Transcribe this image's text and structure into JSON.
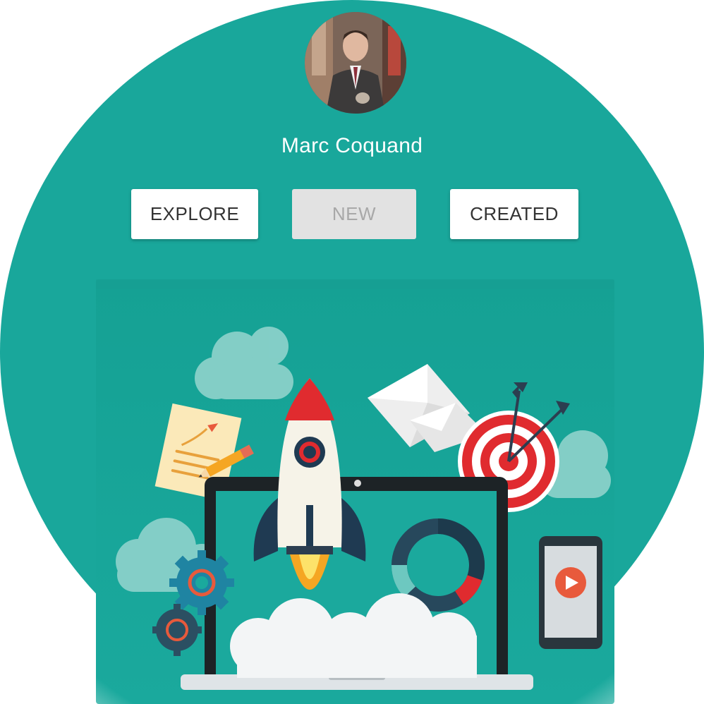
{
  "profile": {
    "name": "Marc Coquand",
    "avatar_icon": "user-photo"
  },
  "tabs": [
    {
      "label": "EXPLORE",
      "active": false
    },
    {
      "label": "NEW",
      "active": true
    },
    {
      "label": "CREATED",
      "active": false
    }
  ],
  "illustration": {
    "icon": "rocket-launch-illustration"
  },
  "colors": {
    "background": "#19a79b",
    "button_bg": "#ffffff",
    "button_disabled_bg": "#e2e2e2",
    "button_disabled_text": "#a8a8a8"
  }
}
